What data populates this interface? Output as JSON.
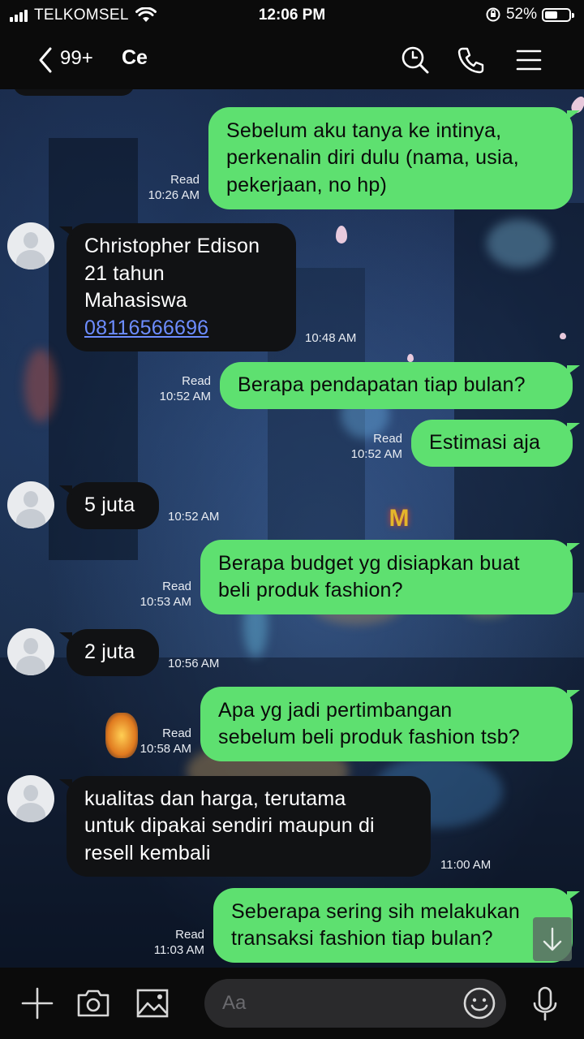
{
  "status_bar": {
    "carrier": "TELKOMSEL",
    "time": "12:06 PM",
    "battery_percent": "52%",
    "battery_level": 0.52
  },
  "header": {
    "unread_count": "99+",
    "chat_name": "Ce",
    "icons": [
      "back-icon",
      "search-icon",
      "phone-icon",
      "menu-icon"
    ]
  },
  "messages": [
    {
      "direction": "out",
      "text": "Sebelum aku tanya ke intinya,\nperkenalin diri dulu (nama, usia,\npekerjaan, no hp)",
      "status": "Read",
      "time": "10:26 AM"
    },
    {
      "direction": "in",
      "lines": [
        "Christopher Edison",
        "21 tahun",
        "Mahasiswa"
      ],
      "phone_link": "08116566696",
      "time": "10:48 AM"
    },
    {
      "direction": "out",
      "text": "Berapa pendapatan tiap bulan?",
      "status": "Read",
      "time": "10:52 AM"
    },
    {
      "direction": "out",
      "text": "Estimasi aja",
      "status": "Read",
      "time": "10:52 AM"
    },
    {
      "direction": "in",
      "text": "5 juta",
      "time": "10:52 AM"
    },
    {
      "direction": "out",
      "text": "Berapa budget yg disiapkan buat\nbeli produk fashion?",
      "status": "Read",
      "time": "10:53 AM"
    },
    {
      "direction": "in",
      "text": "2 juta",
      "time": "10:56 AM"
    },
    {
      "direction": "out",
      "text": "Apa yg jadi pertimbangan\nsebelum beli produk fashion tsb?",
      "status": "Read",
      "time": "10:58 AM"
    },
    {
      "direction": "in",
      "text": "kualitas dan harga, terutama\nuntuk dipakai sendiri maupun di\nresell kembali",
      "time": "11:00 AM"
    },
    {
      "direction": "out",
      "text": "Seberapa sering sih melakukan\ntransaksi fashion tiap bulan?",
      "status": "Read",
      "time": "11:03 AM"
    }
  ],
  "input_bar": {
    "placeholder": "Aa",
    "icons": [
      "plus-icon",
      "camera-icon",
      "image-icon",
      "emoji-icon",
      "microphone-icon"
    ]
  },
  "colors": {
    "outgoing_bubble": "#5ee070",
    "incoming_bubble": "#111214",
    "bar_background": "#0b0b0b",
    "link": "#6d8dff"
  }
}
